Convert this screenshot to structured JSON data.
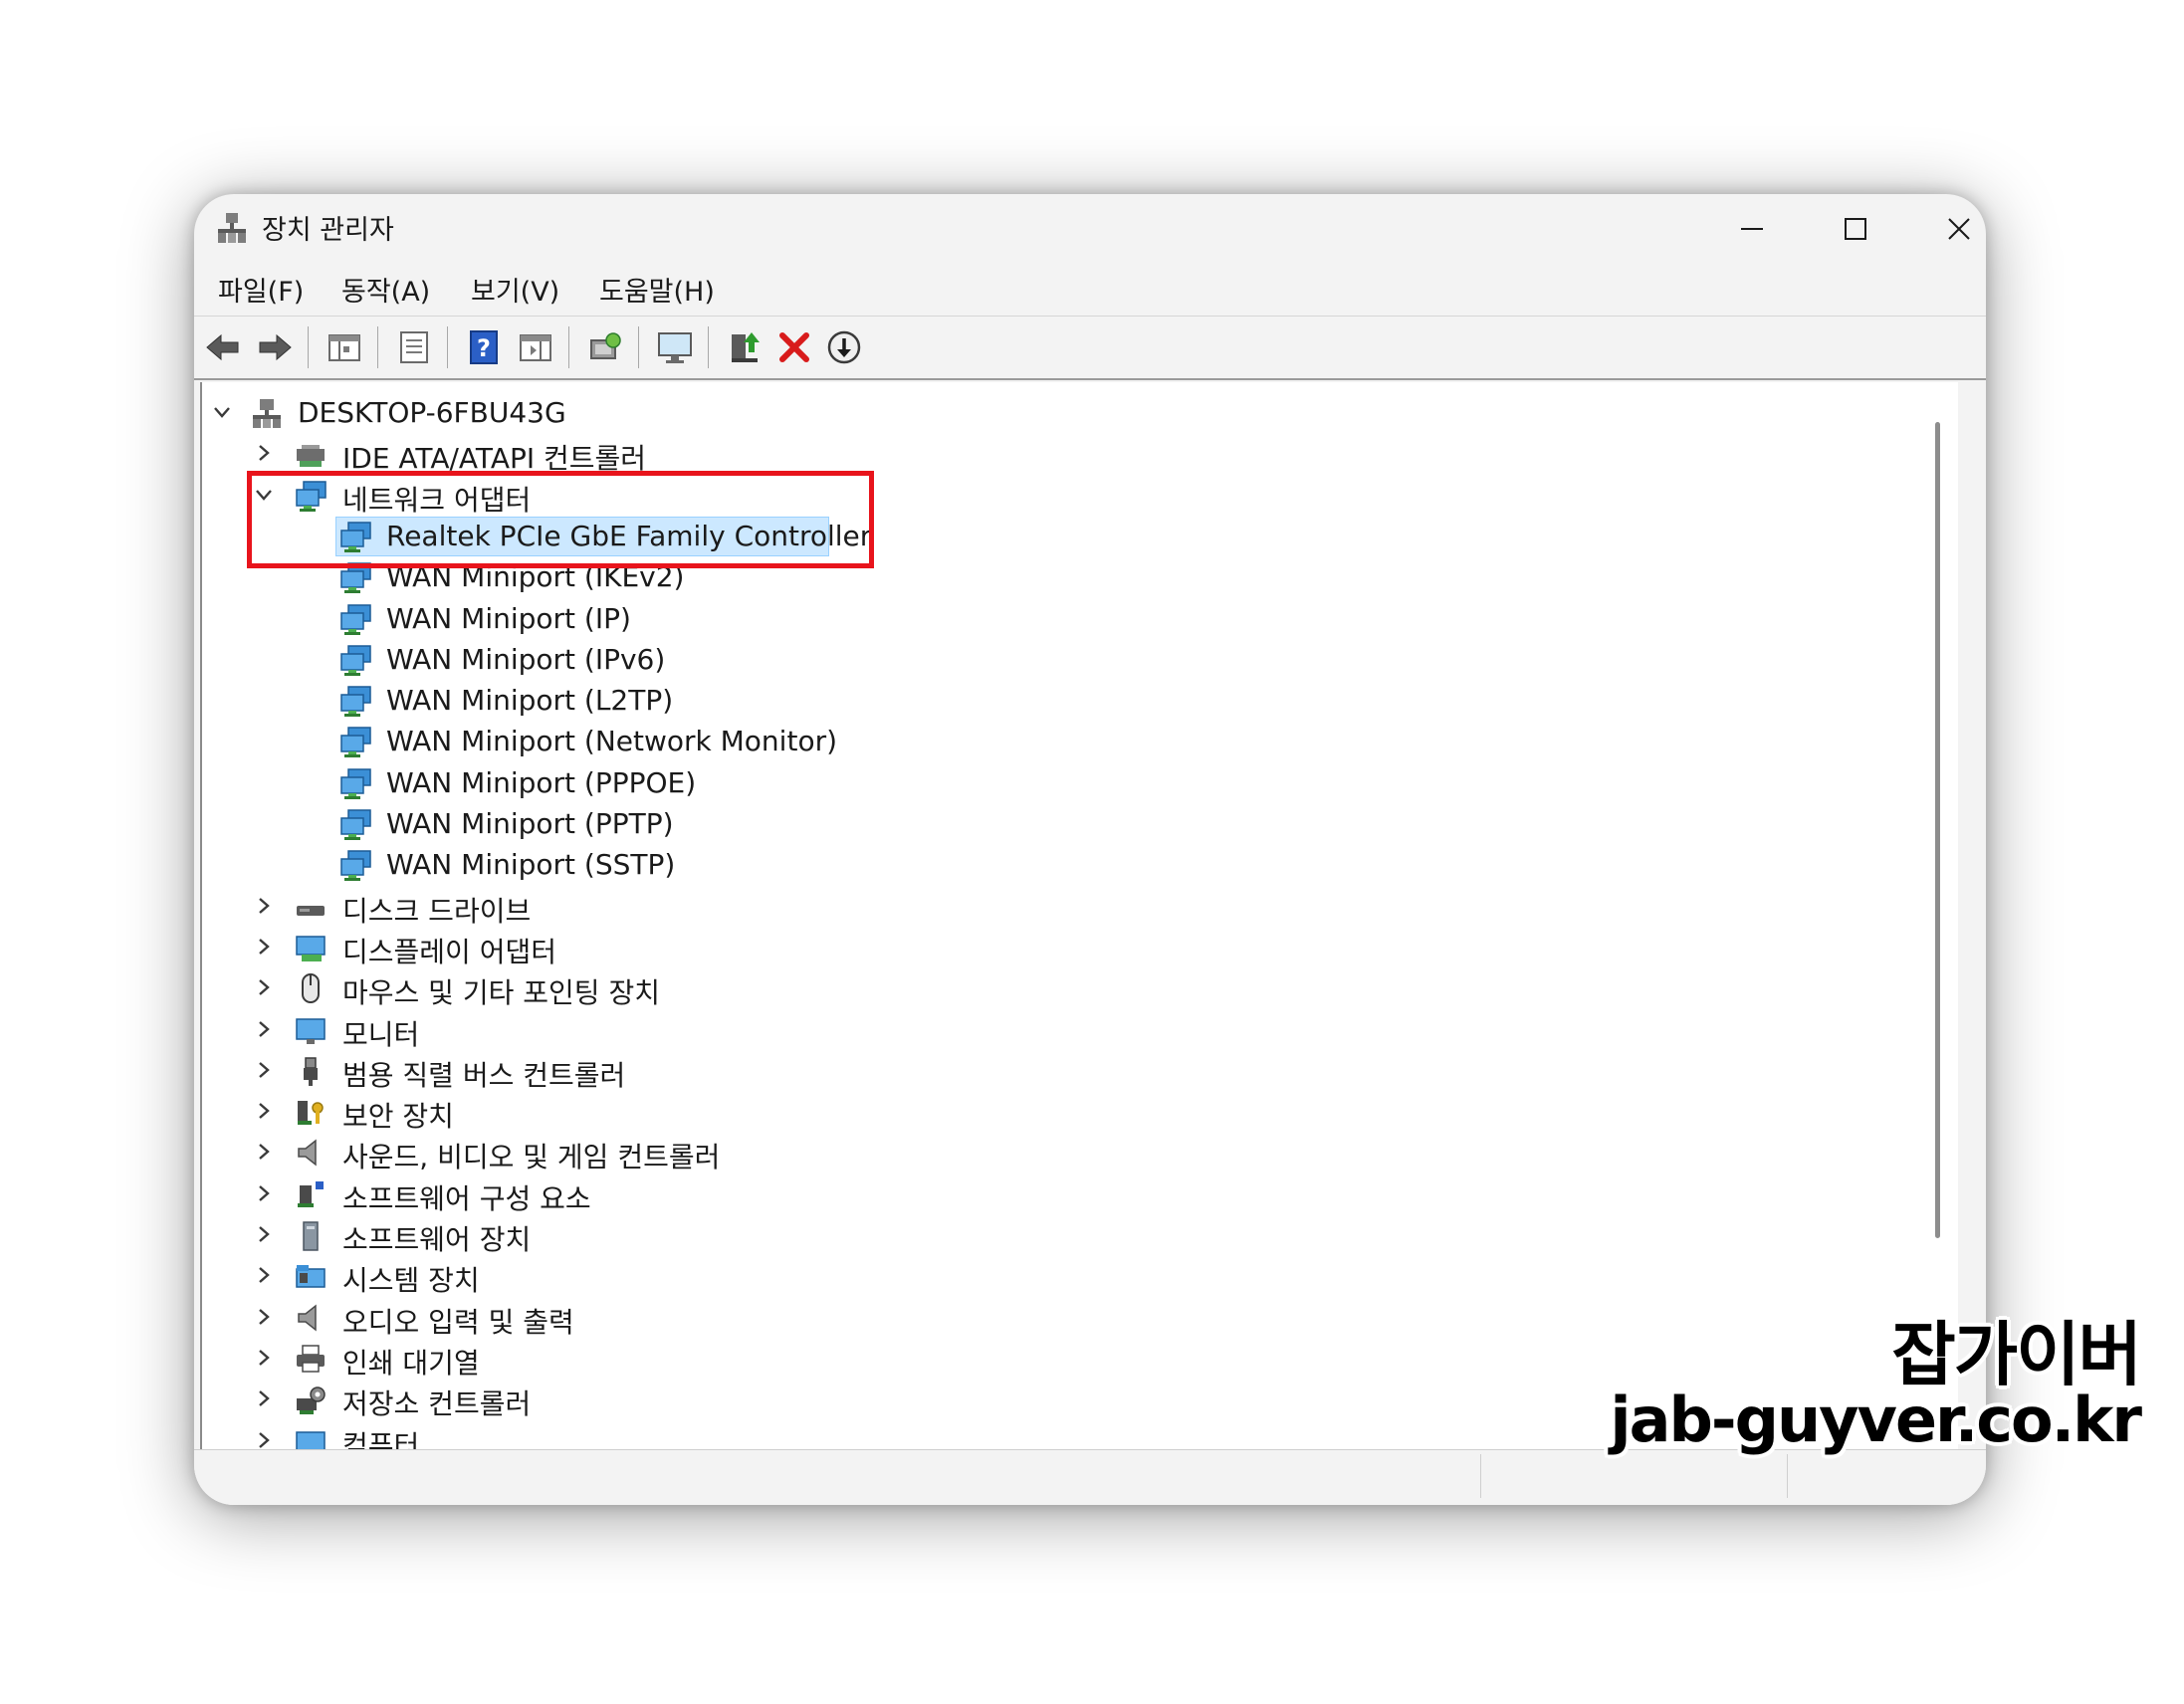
{
  "window": {
    "title": "장치 관리자",
    "controls": {
      "minimize": "minimize-icon",
      "maximize": "maximize-icon",
      "close": "close-icon"
    }
  },
  "menu": [
    {
      "label": "파일(F)"
    },
    {
      "label": "동작(A)"
    },
    {
      "label": "보기(V)"
    },
    {
      "label": "도움말(H)"
    }
  ],
  "toolbar": {
    "icons": [
      "back-arrow-icon",
      "forward-arrow-icon",
      "show-hide-console-tree-icon",
      "properties-icon",
      "help-icon",
      "action-pane-icon",
      "scan-hardware-icon",
      "display-monitor-icon",
      "update-driver-icon",
      "uninstall-device-icon",
      "disable-device-icon"
    ],
    "accent_colors": {
      "arrows": "#4a4a4a",
      "help": "#2b5fc6",
      "update": "#2e8b2e",
      "delete": "#d81b1b"
    }
  },
  "tree": {
    "root": {
      "label": "DESKTOP-6FBU43G",
      "expanded": true
    },
    "categories": [
      {
        "label": "IDE ATA/ATAPI 컨트롤러",
        "icon": "ide-controller-icon",
        "expanded": false
      },
      {
        "label": "네트워크 어댑터",
        "icon": "network-adapter-icon",
        "expanded": true,
        "children": [
          {
            "label": "Realtek PCIe GbE Family Controller",
            "selected": true
          },
          {
            "label": "WAN Miniport (IKEv2)"
          },
          {
            "label": "WAN Miniport (IP)"
          },
          {
            "label": "WAN Miniport (IPv6)"
          },
          {
            "label": "WAN Miniport (L2TP)"
          },
          {
            "label": "WAN Miniport (Network Monitor)"
          },
          {
            "label": "WAN Miniport (PPPOE)"
          },
          {
            "label": "WAN Miniport (PPTP)"
          },
          {
            "label": "WAN Miniport (SSTP)"
          }
        ]
      },
      {
        "label": "디스크 드라이브",
        "icon": "disk-drive-icon",
        "expanded": false
      },
      {
        "label": "디스플레이 어댑터",
        "icon": "display-adapter-icon",
        "expanded": false
      },
      {
        "label": "마우스 및 기타 포인팅 장치",
        "icon": "mouse-icon",
        "expanded": false
      },
      {
        "label": "모니터",
        "icon": "monitor-icon",
        "expanded": false
      },
      {
        "label": "범용 직렬 버스 컨트롤러",
        "icon": "usb-icon",
        "expanded": false
      },
      {
        "label": "보안 장치",
        "icon": "security-device-icon",
        "expanded": false
      },
      {
        "label": "사운드, 비디오 및 게임 컨트롤러",
        "icon": "speaker-icon",
        "expanded": false
      },
      {
        "label": "소프트웨어 구성 요소",
        "icon": "software-component-icon",
        "expanded": false
      },
      {
        "label": "소프트웨어 장치",
        "icon": "software-device-icon",
        "expanded": false
      },
      {
        "label": "시스템 장치",
        "icon": "system-device-icon",
        "expanded": false
      },
      {
        "label": "오디오 입력 및 출력",
        "icon": "audio-io-icon",
        "expanded": false
      },
      {
        "label": "인쇄 대기열",
        "icon": "printer-icon",
        "expanded": false
      },
      {
        "label": "저장소 컨트롤러",
        "icon": "storage-controller-icon",
        "expanded": false
      },
      {
        "label": "컴퓨터",
        "icon": "computer-icon",
        "expanded": false
      }
    ]
  },
  "highlight_color": "#e8141c",
  "selection_color": "#cce8ff",
  "watermark": {
    "line1": "잡가이버",
    "line2": "jab-guyver.co.kr"
  }
}
